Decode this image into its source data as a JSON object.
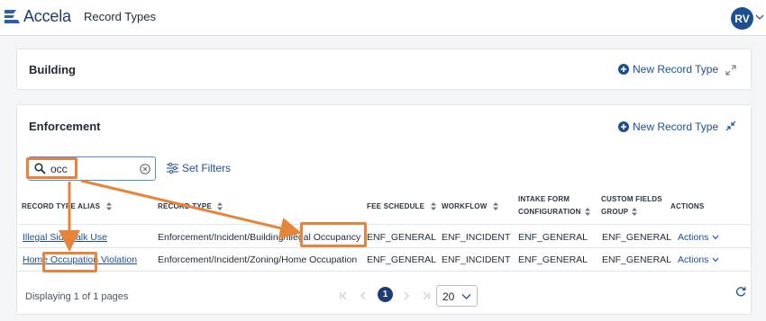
{
  "header": {
    "logo_text": "Accela",
    "title": "Record Types",
    "avatar_initials": "RV"
  },
  "building": {
    "title": "Building",
    "new_record_type": "New Record Type"
  },
  "enforcement": {
    "title": "Enforcement",
    "new_record_type": "New Record Type",
    "search_value": "occ",
    "set_filters": "Set Filters",
    "columns": {
      "alias": "RECORD TYPE ALIAS",
      "record_type": "RECORD TYPE",
      "fee_schedule": "FEE SCHEDULE",
      "workflow": "WORKFLOW",
      "intake_1": "INTAKE FORM",
      "intake_2": "CONFIGURATION",
      "custom_1": "CUSTOM FIELDS",
      "custom_2": "GROUP",
      "actions": "ACTIONS"
    },
    "rows": [
      {
        "alias": "Illegal Sidewalk Use",
        "record_type": "Enforcement/Incident/Building/Illegal Occupancy",
        "fee_schedule": "ENF_GENERAL",
        "workflow": "ENF_INCIDENT",
        "intake": "ENF_GENERAL",
        "custom": "ENF_GENERAL",
        "actions": "Actions"
      },
      {
        "alias": "Home Occupation Violation",
        "record_type": "Enforcement/Incident/Zoning/Home Occupation",
        "fee_schedule": "ENF_GENERAL",
        "workflow": "ENF_INCIDENT",
        "intake": "ENF_GENERAL",
        "custom": "ENF_GENERAL",
        "actions": "Actions"
      }
    ],
    "footer": {
      "displaying": "Displaying 1 of 1 pages",
      "current_page": "1",
      "page_size": "20"
    }
  },
  "colors": {
    "brand": "#1d4f91",
    "highlight": "#e5843a"
  },
  "icons": [
    "accela-logo-icon",
    "chevron-down-icon",
    "plus-circle-icon",
    "expand-icon",
    "collapse-icon",
    "search-icon",
    "clear-icon",
    "filter-icon",
    "sort-icon",
    "first-page-icon",
    "prev-page-icon",
    "next-page-icon",
    "last-page-icon",
    "refresh-icon"
  ]
}
